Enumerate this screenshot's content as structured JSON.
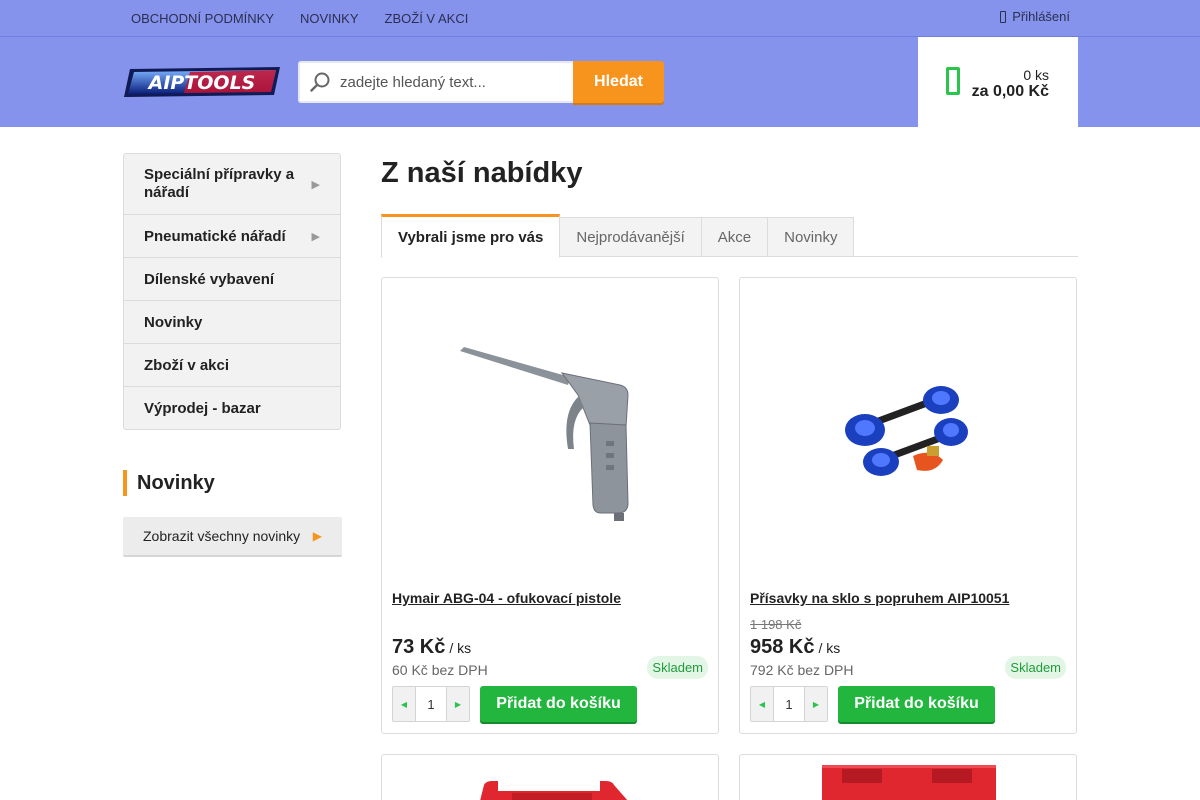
{
  "topbar": {
    "links": [
      "OBCHODNÍ PODMÍNKY",
      "NOVINKY",
      "ZBOŽÍ V AKCI"
    ],
    "login": "Přihlášení"
  },
  "header": {
    "logo_text": "AIPTOOLS",
    "search_placeholder": "zadejte hledaný text...",
    "search_button": "Hledat",
    "cart_qty": "0 ks",
    "cart_total": "za 0,00 Kč"
  },
  "sidebar": {
    "items": [
      {
        "label": "Speciální přípravky a nářadí",
        "has_sub": true
      },
      {
        "label": "Pneumatické nářadí",
        "has_sub": true
      },
      {
        "label": "Dílenské vybavení",
        "has_sub": false
      },
      {
        "label": "Novinky",
        "has_sub": false
      },
      {
        "label": "Zboží v akci",
        "has_sub": false
      },
      {
        "label": "Výprodej - bazar",
        "has_sub": false
      }
    ],
    "news_title": "Novinky",
    "news_all": "Zobrazit všechny novinky"
  },
  "main": {
    "title": "Z naší nabídky",
    "tabs": [
      "Vybrali jsme pro vás",
      "Nejprodávanější",
      "Akce",
      "Novinky"
    ],
    "products": [
      {
        "name": "Hymair ABG-04 - ofukovací pistole",
        "old_price": "",
        "price": "73 Kč",
        "unit": "/ ks",
        "net": "60 Kč bez DPH",
        "stock": "Skladem",
        "qty": "1",
        "add": "Přidat do košíku"
      },
      {
        "name": "Přísavky na sklo s popruhem AIP10051",
        "old_price": "1 198 Kč",
        "price": "958 Kč",
        "unit": "/ ks",
        "net": "792 Kč bez DPH",
        "stock": "Skladem",
        "qty": "1",
        "add": "Přidat do košíku"
      }
    ]
  },
  "colors": {
    "header_bg": "#8593ec",
    "accent_orange": "#f7941d",
    "add_green": "#22b63f",
    "stock_green": "#1f9c3b"
  }
}
